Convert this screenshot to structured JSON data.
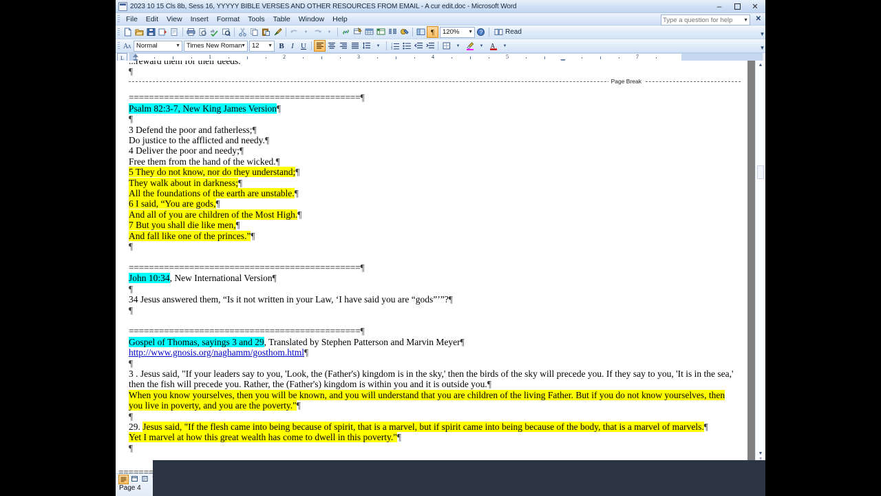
{
  "window": {
    "title": "2023 10 15 Cls 8b, Sess 16, YYYYY BIBLE VERSES AND OTHER RESOURCES FROM EMAIL - A cur edit.doc - Microsoft Word",
    "minimize_label": "–",
    "restore_label": "❐",
    "close_label": "✕"
  },
  "menu": {
    "items": [
      "File",
      "Edit",
      "View",
      "Insert",
      "Format",
      "Tools",
      "Table",
      "Window",
      "Help"
    ],
    "help_placeholder": "Type a question for help",
    "help_value": "",
    "help_close_label": "✕"
  },
  "toolbar_standard": {
    "zoom_value": "120%",
    "read_label": "Read",
    "icons": [
      "new-document-icon",
      "open-folder-icon",
      "save-icon",
      "email-icon",
      "print-preview-icon",
      "print-icon",
      "print-preview-2-icon",
      "spelling-check-icon",
      "research-icon",
      "cut-icon",
      "copy-icon",
      "paste-icon",
      "format-painter-icon",
      "undo-icon",
      "redo-icon",
      "insert-hyperlink-icon",
      "tables-borders-icon",
      "insert-table-icon",
      "insert-excel-sheet-icon",
      "columns-icon",
      "drawing-icon",
      "document-map-icon",
      "show-formatting-marks-icon"
    ]
  },
  "toolbar_formatting": {
    "style_value": "Normal",
    "font_value": "Times New Roman",
    "size_value": "12",
    "bold_label": "B",
    "italic_label": "I",
    "underline_label": "U",
    "icons": [
      "styles-and-formatting-icon",
      "align-left-icon",
      "align-center-icon",
      "align-right-icon",
      "justify-icon",
      "line-spacing-icon",
      "numbered-list-icon",
      "bulleted-list-icon",
      "decrease-indent-icon",
      "increase-indent-icon",
      "borders-icon",
      "highlight-color-icon",
      "font-color-icon"
    ]
  },
  "ruler": {
    "corner_label": "L",
    "numbers": [
      "1",
      "2",
      "3",
      "4",
      "5",
      "7"
    ]
  },
  "document": {
    "clipped_top_line": "...reward them for their deeds.",
    "page_break_label": "Page Break",
    "separator": "==============================================",
    "blocks": [
      {
        "id": "psalm",
        "heading": "Psalm 82:3-7, New King James Version",
        "heading_highlight": "cyan",
        "lines": [
          {
            "text": "3 Defend the poor and fatherless;",
            "highlight": "none"
          },
          {
            "text": "Do justice to the afflicted and needy.",
            "highlight": "none"
          },
          {
            "text": "4 Deliver the poor and needy;",
            "highlight": "none"
          },
          {
            "text": "Free them from the hand of the wicked.",
            "highlight": "none"
          },
          {
            "text": "5 They do not know, nor do they understand;",
            "highlight": "yellow"
          },
          {
            "text": "They walk about in darkness;",
            "highlight": "yellow"
          },
          {
            "text": "All the foundations of the earth are unstable.",
            "highlight": "yellow"
          },
          {
            "text": "6 I said, “You are gods,",
            "highlight": "yellow",
            "caret": true
          },
          {
            "text": "And all of you are children of the Most High.",
            "highlight": "yellow"
          },
          {
            "text": "7 But you shall die like men,",
            "highlight": "yellow"
          },
          {
            "text": "And fall like one of the princes.”",
            "highlight": "yellow"
          }
        ]
      },
      {
        "id": "john",
        "heading_highlighted_part": "John 10:34",
        "heading_rest": ", New International Version",
        "heading_highlight": "cyan",
        "body": "34 Jesus answered them, “Is it not written in your Law, ‘I have said you are “gods”’”?"
      },
      {
        "id": "thomas",
        "heading_highlighted_part": "Gospel of Thomas, sayings 3 and 29",
        "heading_rest": ", Translated by Stephen Patterson and Marvin Meyer",
        "heading_highlight": "cyan",
        "link": "http://www.gnosis.org/naghamm/gosthom.html",
        "saying3_plain": "3 . Jesus said, \"If your leaders say to you, 'Look, the (Father's) kingdom is in the sky,' then the birds of the sky will precede you. If they say to you, 'It is in the sea,' then the fish will precede you. Rather, the (Father's) kingdom is within you and it is outside you.",
        "saying3_highlighted": "When you know yourselves, then you will be known, and you will understand that you are children of the living Father. But if you do not know yourselves, then you live in poverty, and you are the poverty.\"",
        "saying29_number": "29. ",
        "saying29_highlighted": "Jesus said, \"If the flesh came into being because of spirit, that is a marvel, but if spirit came into being because of the body, that is a marvel of marvels.",
        "saying29_line3": "Yet I marvel at how this great wealth has come to dwell in this poverty.\""
      }
    ]
  },
  "status_bar": {
    "page_label": "Page  4",
    "view_buttons": [
      "normal-view-icon",
      "web-layout-view-icon",
      "print-layout-view-icon",
      "outline-view-icon"
    ]
  },
  "scrollbar": {
    "up_arrow": "▲",
    "down_arrow": "▼",
    "prev_page": "⤒",
    "select_browse": "●",
    "next_page": "⤓"
  },
  "colors": {
    "highlight_yellow": "#ffff00",
    "highlight_cyan": "#00ffff",
    "hyperlink_blue": "#0000cc",
    "titlebar_blue": "#cfe0f5",
    "accent_orange": "#ffbe63",
    "overlay_dark": "#2b3442"
  }
}
